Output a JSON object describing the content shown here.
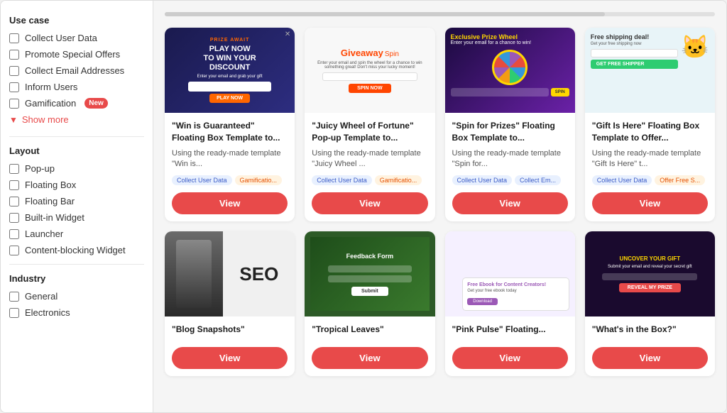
{
  "sidebar": {
    "use_case_title": "Use case",
    "filters_use_case": [
      {
        "id": "collect-user-data",
        "label": "Collect User Data",
        "checked": false
      },
      {
        "id": "promote-special-offers",
        "label": "Promote Special Offers",
        "checked": false
      },
      {
        "id": "collect-email",
        "label": "Collect Email Addresses",
        "checked": false
      },
      {
        "id": "inform-users",
        "label": "Inform Users",
        "checked": false
      },
      {
        "id": "gamification",
        "label": "Gamification",
        "checked": false,
        "badge": "New"
      }
    ],
    "show_more_label": "Show more",
    "layout_title": "Layout",
    "filters_layout": [
      {
        "id": "popup",
        "label": "Pop-up",
        "checked": false
      },
      {
        "id": "floating-box",
        "label": "Floating Box",
        "checked": false
      },
      {
        "id": "floating-bar",
        "label": "Floating Bar",
        "checked": false
      },
      {
        "id": "built-in-widget",
        "label": "Built-in Widget",
        "checked": false
      },
      {
        "id": "launcher",
        "label": "Launcher",
        "checked": false
      },
      {
        "id": "content-blocking",
        "label": "Content-blocking Widget",
        "checked": false
      }
    ],
    "industry_title": "Industry",
    "filters_industry": [
      {
        "id": "general",
        "label": "General",
        "checked": false
      },
      {
        "id": "electronics",
        "label": "Electronics",
        "checked": false
      }
    ]
  },
  "cards": [
    {
      "title": "\"Win is Guaranteed\" Floating Box Template to...",
      "desc": "Using the ready-made template \"Win is...",
      "tags": [
        "Collect User Data",
        "Gamificatio..."
      ],
      "view_label": "View",
      "preview_type": "win"
    },
    {
      "title": "\"Juicy Wheel of Fortune\" Pop-up Template to...",
      "desc": "Using the ready-made template \"Juicy Wheel ...",
      "tags": [
        "Collect User Data",
        "Gamificatio..."
      ],
      "view_label": "View",
      "preview_type": "giveaway"
    },
    {
      "title": "\"Spin for Prizes\" Floating Box Template to...",
      "desc": "Using the ready-made template \"Spin for...",
      "tags": [
        "Collect User Data",
        "Collect Em..."
      ],
      "view_label": "View",
      "preview_type": "prize"
    },
    {
      "title": "\"Gift Is Here\" Floating Box Template to Offer...",
      "desc": "Using the ready-made template \"Gift Is Here\" t...",
      "tags": [
        "Collect User Data",
        "Offer Free S..."
      ],
      "view_label": "View",
      "preview_type": "shipping"
    },
    {
      "title": "\"Blog Snapshots\"",
      "desc": "",
      "tags": [],
      "view_label": "View",
      "preview_type": "blog"
    },
    {
      "title": "\"Tropical Leaves\"",
      "desc": "",
      "tags": [],
      "view_label": "View",
      "preview_type": "tropical"
    },
    {
      "title": "\"Pink Pulse\" Floating...",
      "desc": "",
      "tags": [],
      "view_label": "View",
      "preview_type": "pink"
    },
    {
      "title": "\"What's in the Box?\"",
      "desc": "",
      "tags": [],
      "view_label": "View",
      "preview_type": "box"
    }
  ],
  "colors": {
    "accent": "#e84a4a",
    "tag_bg": "#e8f0fe",
    "tag_color": "#3a5bc7"
  }
}
